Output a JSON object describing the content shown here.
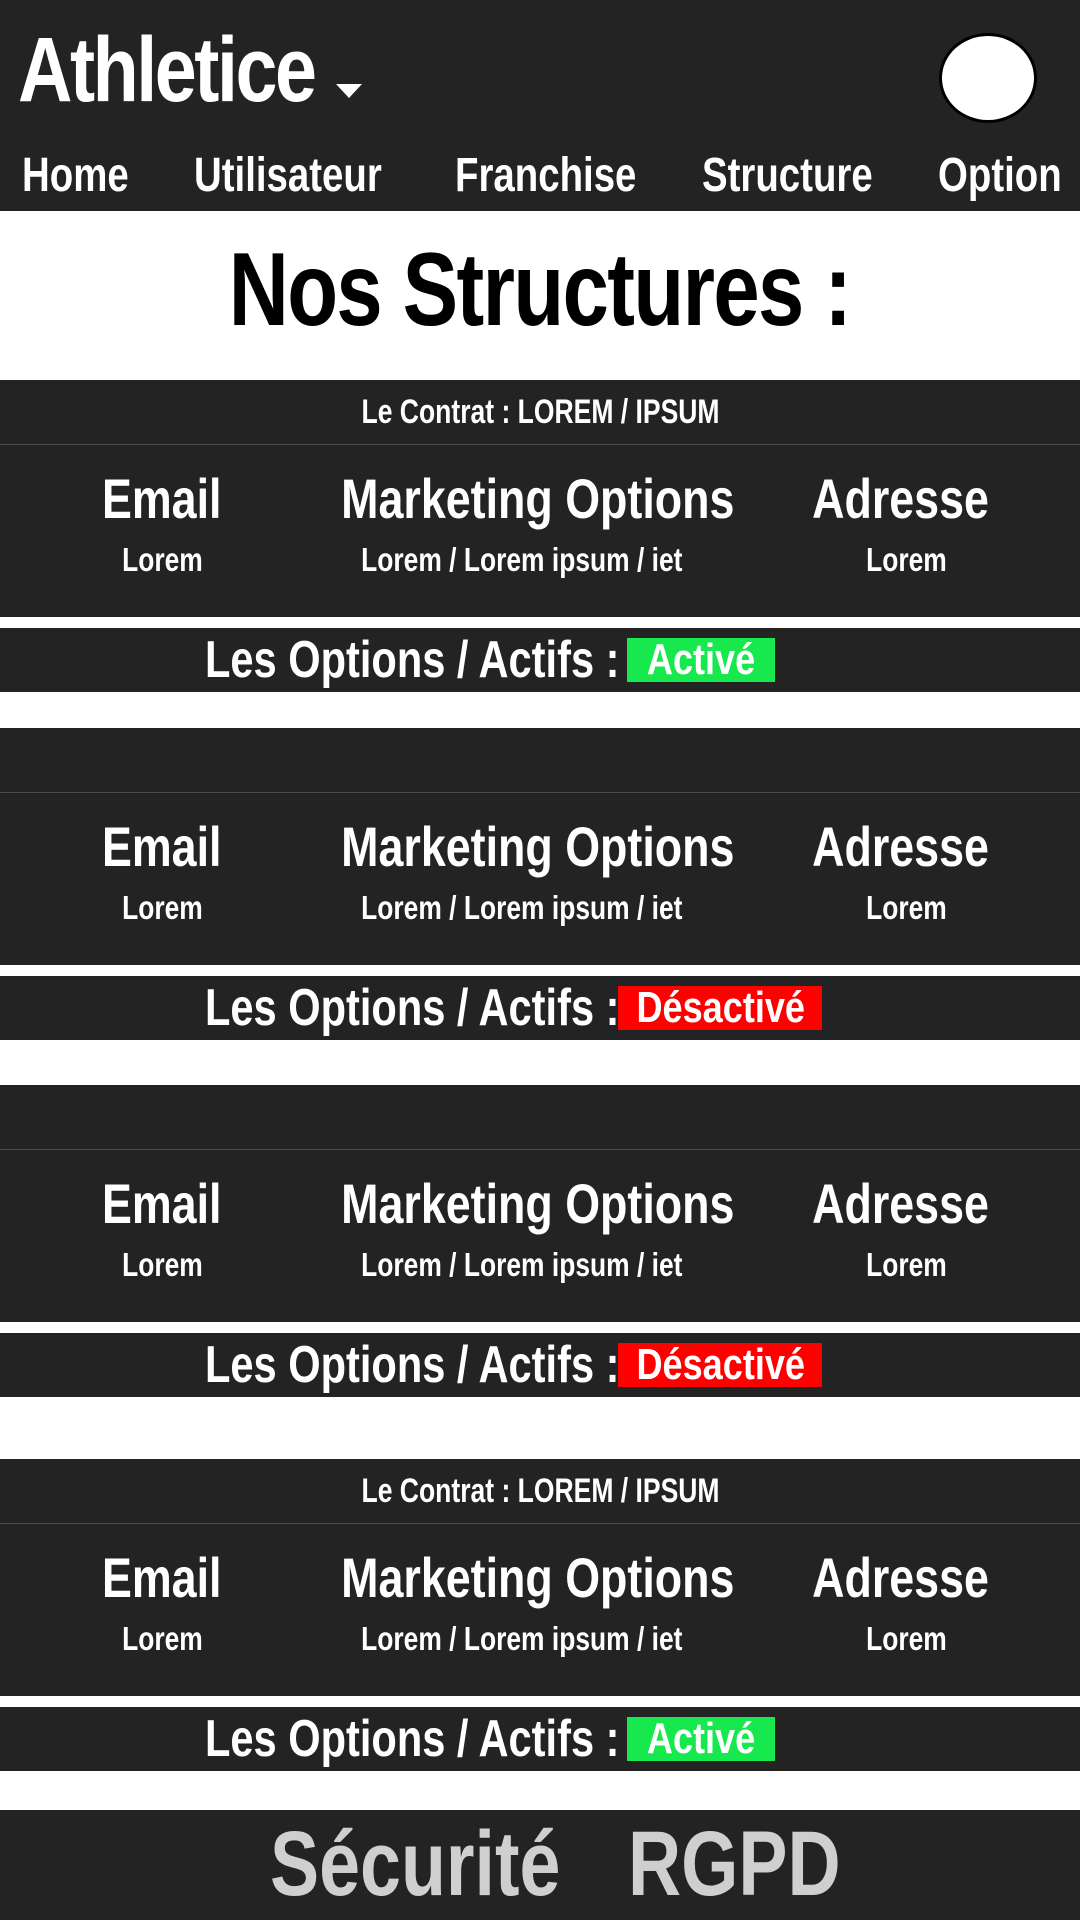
{
  "header": {
    "app_title": "Athletice",
    "nav": [
      "Home",
      "Utilisateur",
      "Franchise",
      "Structure",
      "Option"
    ]
  },
  "page_title": "Nos Structures :",
  "columns": {
    "email": "Email",
    "marketing": "Marketing Options",
    "adresse": "Adresse"
  },
  "options_label": "Les Options / Actifs :",
  "structures": [
    {
      "contract": "Le Contrat : LOREM / IPSUM",
      "email": "Lorem",
      "marketing": "Lorem / Lorem ipsum / iet",
      "adresse": "Lorem",
      "status": "Activé"
    },
    {
      "contract": "",
      "email": "Lorem",
      "marketing": "Lorem / Lorem ipsum / iet",
      "adresse": "Lorem",
      "status": "Désactivé"
    },
    {
      "contract": "",
      "email": "Lorem",
      "marketing": "Lorem / Lorem ipsum / iet",
      "adresse": "Lorem",
      "status": "Désactivé"
    },
    {
      "contract": "Le Contrat : LOREM / IPSUM",
      "email": "Lorem",
      "marketing": "Lorem / Lorem ipsum / iet",
      "adresse": "Lorem",
      "status": "Activé"
    }
  ],
  "footer": {
    "security": "Sécurité",
    "rgpd": "RGPD"
  },
  "colors": {
    "dark": "#232323",
    "active": "#16e84e",
    "inactive": "#ff0000",
    "footer_text": "#cfcfcf"
  }
}
